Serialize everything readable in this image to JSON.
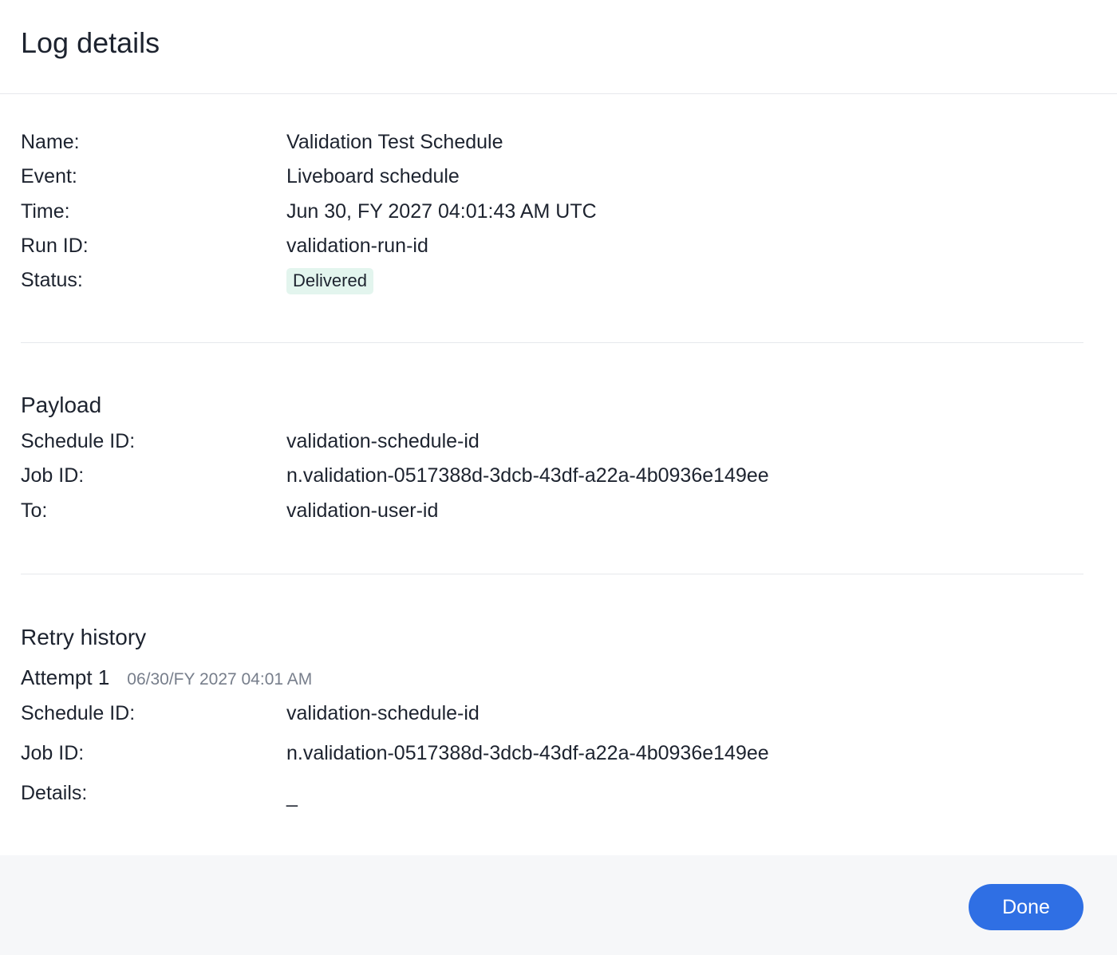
{
  "dialog": {
    "title": "Log details"
  },
  "general": {
    "rows": [
      {
        "label": "Name:",
        "value": "Validation Test Schedule"
      },
      {
        "label": "Event:",
        "value": "Liveboard schedule"
      },
      {
        "label": "Time:",
        "value": "Jun 30, FY 2027 04:01:43 AM UTC"
      },
      {
        "label": "Run ID:",
        "value": "validation-run-id"
      }
    ],
    "status": {
      "label": "Status:",
      "value": "Delivered",
      "color": "#e3f5ee"
    }
  },
  "payload": {
    "title": "Payload",
    "rows": [
      {
        "label": "Schedule ID:",
        "value": "validation-schedule-id"
      },
      {
        "label": "Job ID:",
        "value": "n.validation-0517388d-3dcb-43df-a22a-4b0936e149ee"
      },
      {
        "label": "To:",
        "value": "validation-user-id"
      }
    ]
  },
  "retry_history": {
    "title": "Retry history",
    "attempts": [
      {
        "title": "Attempt 1",
        "time": "06/30/FY 2027 04:01 AM",
        "rows": [
          {
            "label": "Schedule ID:",
            "value": "validation-schedule-id"
          },
          {
            "label": "Job ID:",
            "value": "n.validation-0517388d-3dcb-43df-a22a-4b0936e149ee"
          },
          {
            "label": "Details:",
            "value": "_"
          }
        ]
      }
    ]
  },
  "footer": {
    "done_label": "Done",
    "accent_color": "#2f6fe4"
  }
}
